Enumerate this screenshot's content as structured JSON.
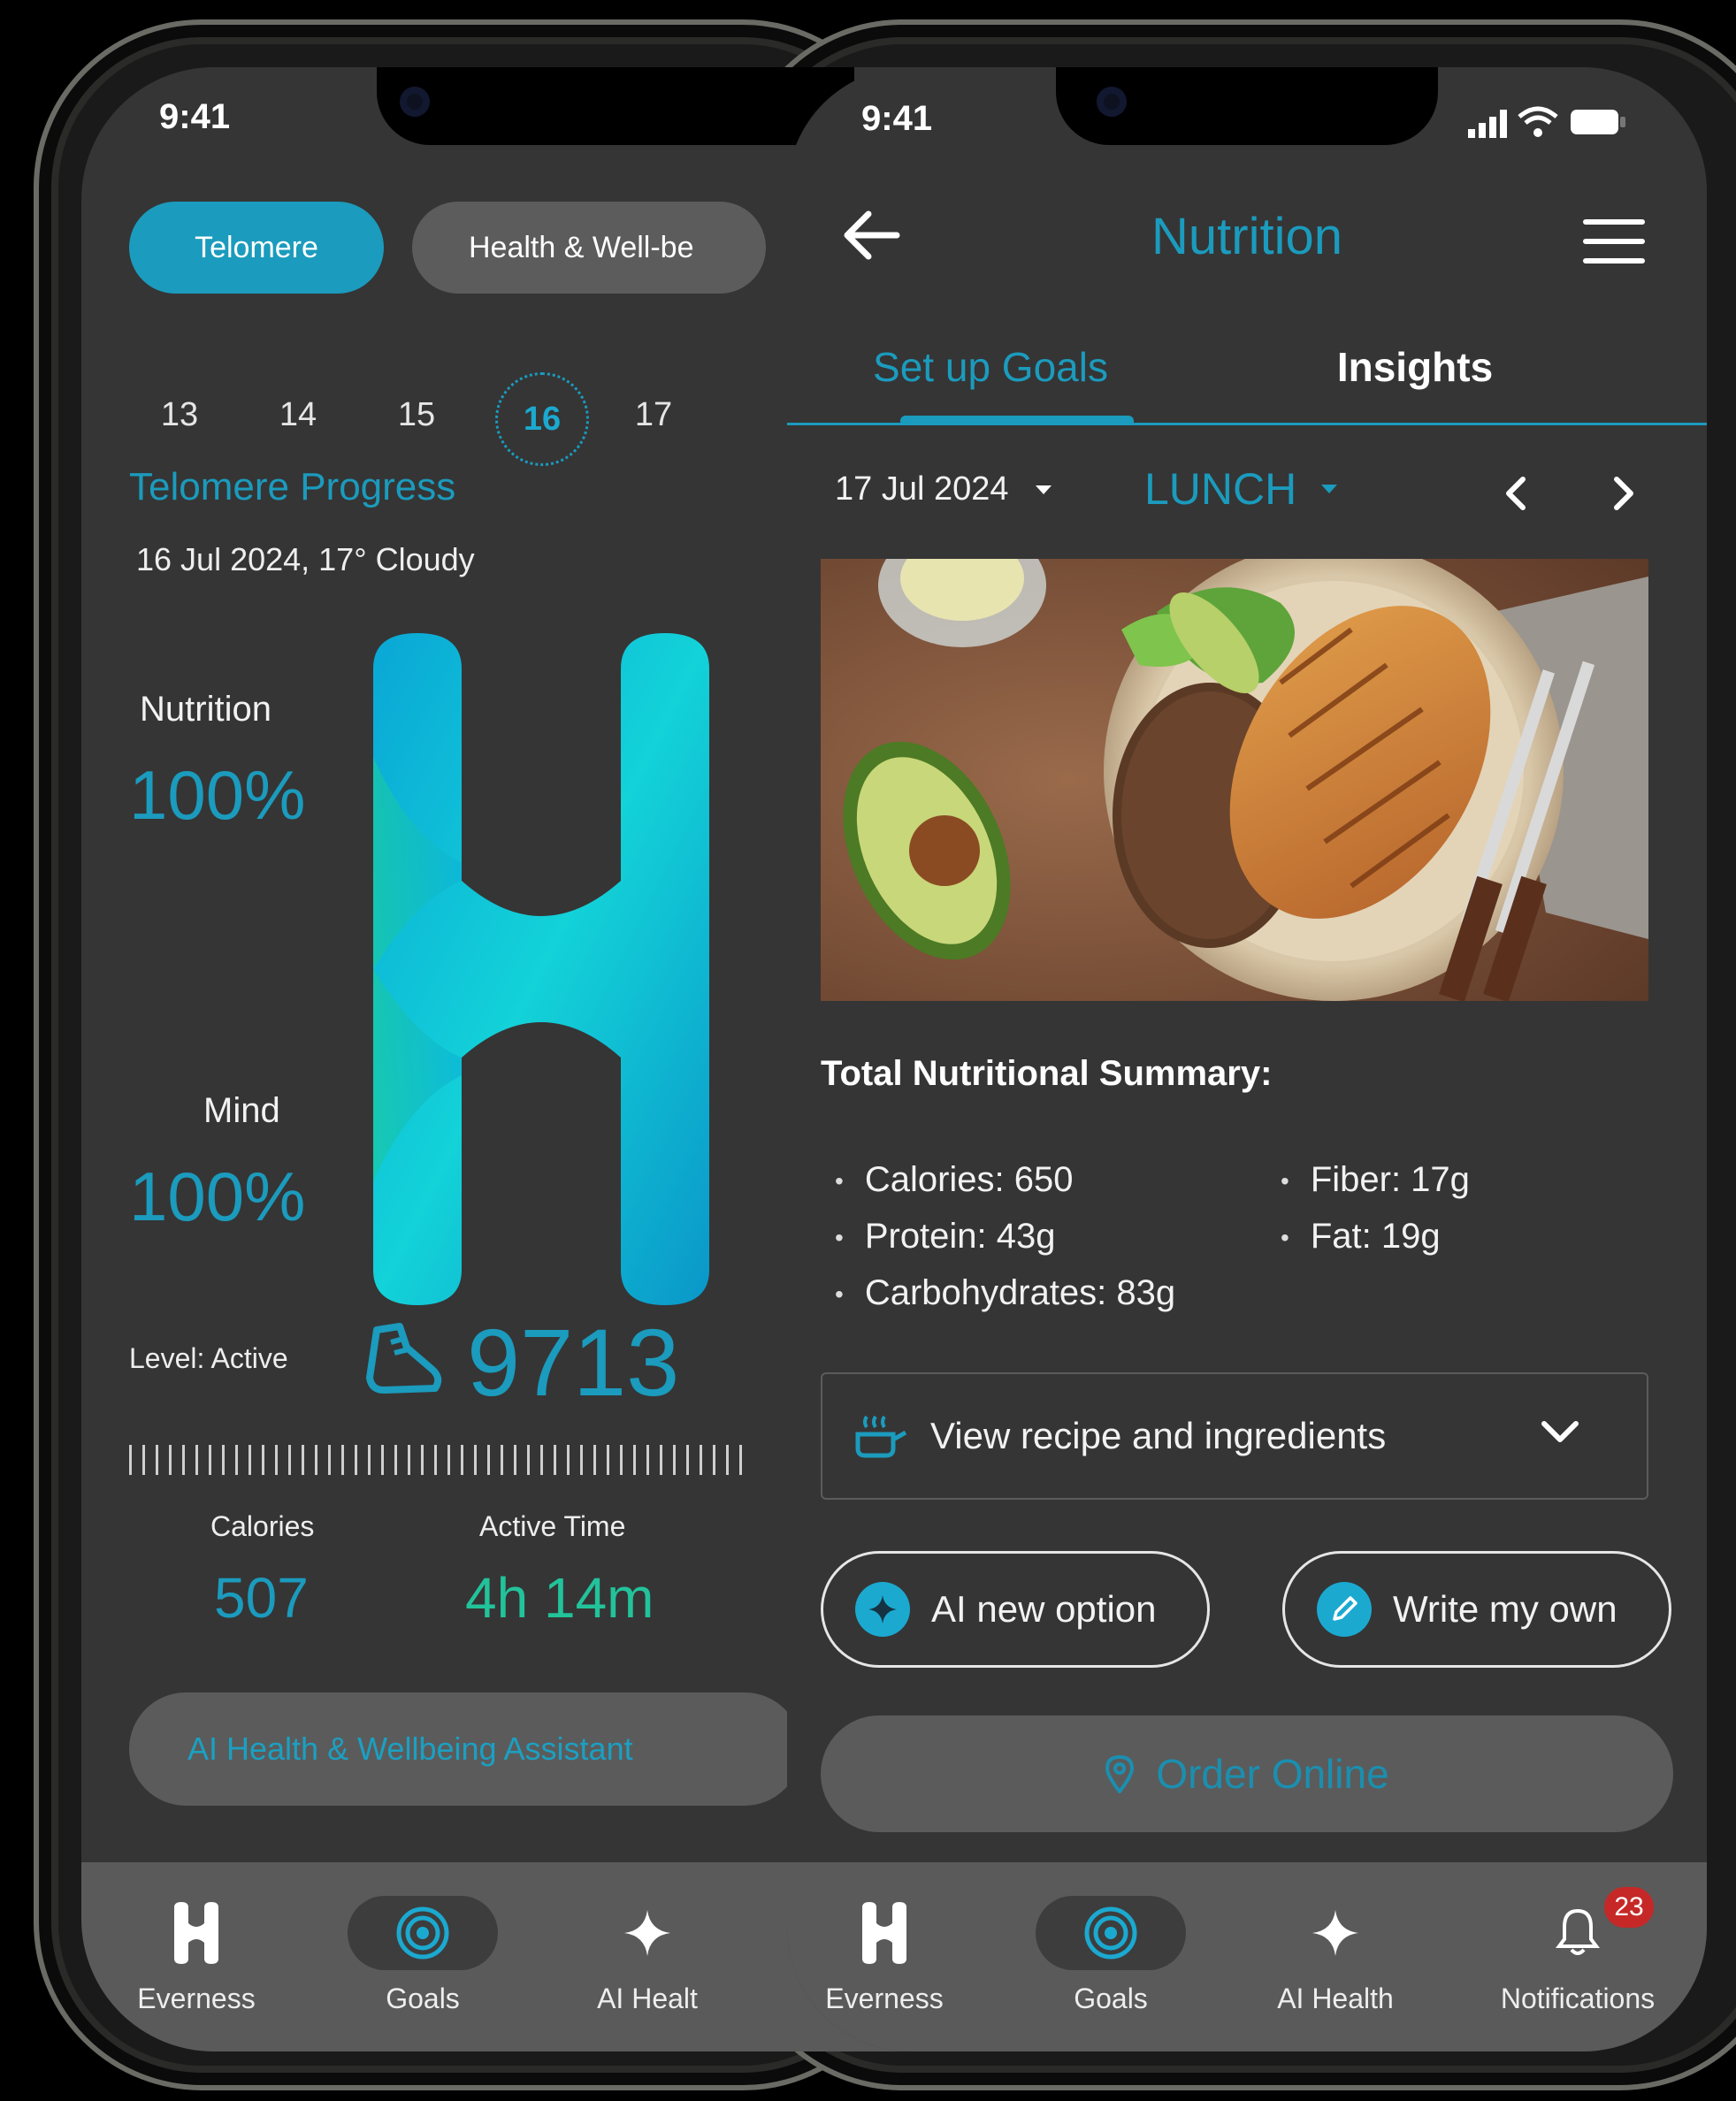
{
  "status": {
    "time": "9:41"
  },
  "left": {
    "tabs": [
      {
        "label": "Telomere"
      },
      {
        "label": "Health & Well-be"
      }
    ],
    "dates": [
      "13",
      "14",
      "15",
      "16",
      "17"
    ],
    "progress_title": "Telomere Progress",
    "weather": "16 Jul 2024, 17° Cloudy",
    "nutrition": {
      "label": "Nutrition",
      "value": "100%"
    },
    "mind": {
      "label": "Mind",
      "value": "100%"
    },
    "level": "Level: Active",
    "steps": "9713",
    "calories": {
      "label": "Calories",
      "value": "507"
    },
    "active_time": {
      "label": "Active Time",
      "value": "4h 14m"
    },
    "assistant_button": "AI Health & Wellbeing Assistant",
    "nav": [
      {
        "label": "Everness",
        "icon": "everness-logo-icon"
      },
      {
        "label": "Goals",
        "icon": "target-icon"
      },
      {
        "label": "AI Healt",
        "icon": "sparkle-icon"
      }
    ]
  },
  "right": {
    "title": "Nutrition",
    "tabs": [
      {
        "label": "Set up Goals"
      },
      {
        "label": "Insights"
      }
    ],
    "date": "17 Jul 2024",
    "meal": "LUNCH",
    "summary_title": "Total Nutritional Summary:",
    "nutrients": [
      "Calories: 650",
      "Protein: 43g",
      "Carbohydrates: 83g",
      "Fiber: 17g",
      "Fat: 19g"
    ],
    "recipe_label": "View recipe and ingredients",
    "ai_option": "AI new option",
    "write_own": "Write my own",
    "order_online": "Order Online",
    "nav": [
      {
        "label": "Everness",
        "icon": "everness-logo-icon"
      },
      {
        "label": "Goals",
        "icon": "target-icon"
      },
      {
        "label": "AI Health",
        "icon": "sparkle-icon"
      },
      {
        "label": "Notifications",
        "icon": "bell-icon",
        "badge": "23"
      }
    ]
  },
  "colors": {
    "accent": "#1b9bbd",
    "active_green": "#22c29a",
    "badge_red": "#c62828",
    "screen_bg": "#353535"
  }
}
